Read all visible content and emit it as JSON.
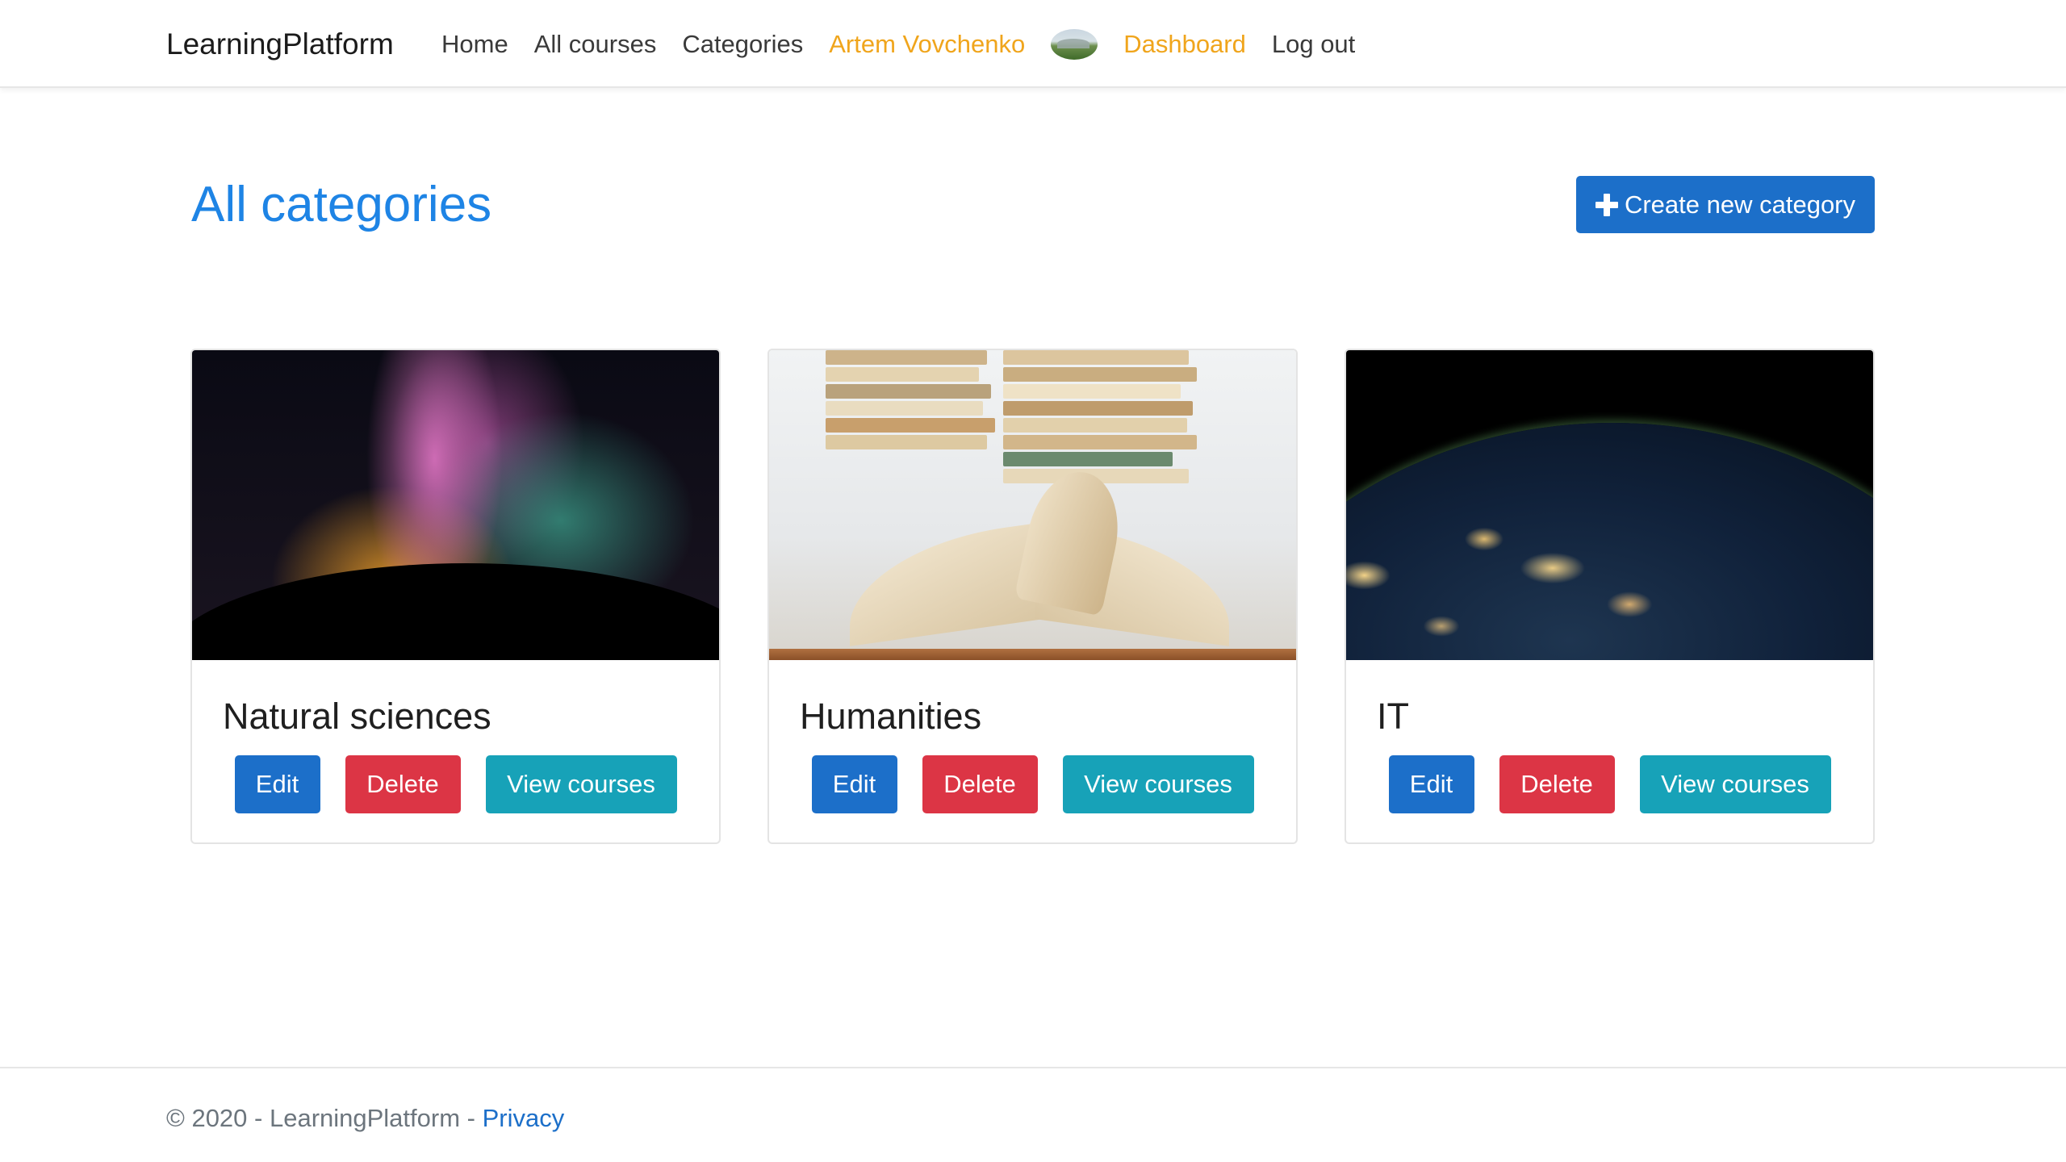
{
  "navbar": {
    "brand": "LearningPlatform",
    "links": [
      {
        "label": "Home"
      },
      {
        "label": "All courses"
      },
      {
        "label": "Categories"
      },
      {
        "label": "Artem Vovchenko"
      },
      {
        "label": "Dashboard"
      },
      {
        "label": "Log out"
      }
    ],
    "accent_color": "#f0a51c"
  },
  "main": {
    "title": "All categories",
    "create_button_label": "Create new category",
    "title_color": "#1e84e5"
  },
  "categories": [
    {
      "name": "Natural sciences",
      "image_icon": "milky-way-image",
      "edit_label": "Edit",
      "delete_label": "Delete",
      "view_label": "View courses"
    },
    {
      "name": "Humanities",
      "image_icon": "open-books-image",
      "edit_label": "Edit",
      "delete_label": "Delete",
      "view_label": "View courses"
    },
    {
      "name": "IT",
      "image_icon": "earth-at-night-image",
      "edit_label": "Edit",
      "delete_label": "Delete",
      "view_label": "View courses"
    }
  ],
  "colors": {
    "primary": "#1c6fc9",
    "danger": "#dc3545",
    "info": "#17a2b8"
  },
  "footer": {
    "text": "© 2020 - LearningPlatform - ",
    "privacy_label": "Privacy"
  }
}
